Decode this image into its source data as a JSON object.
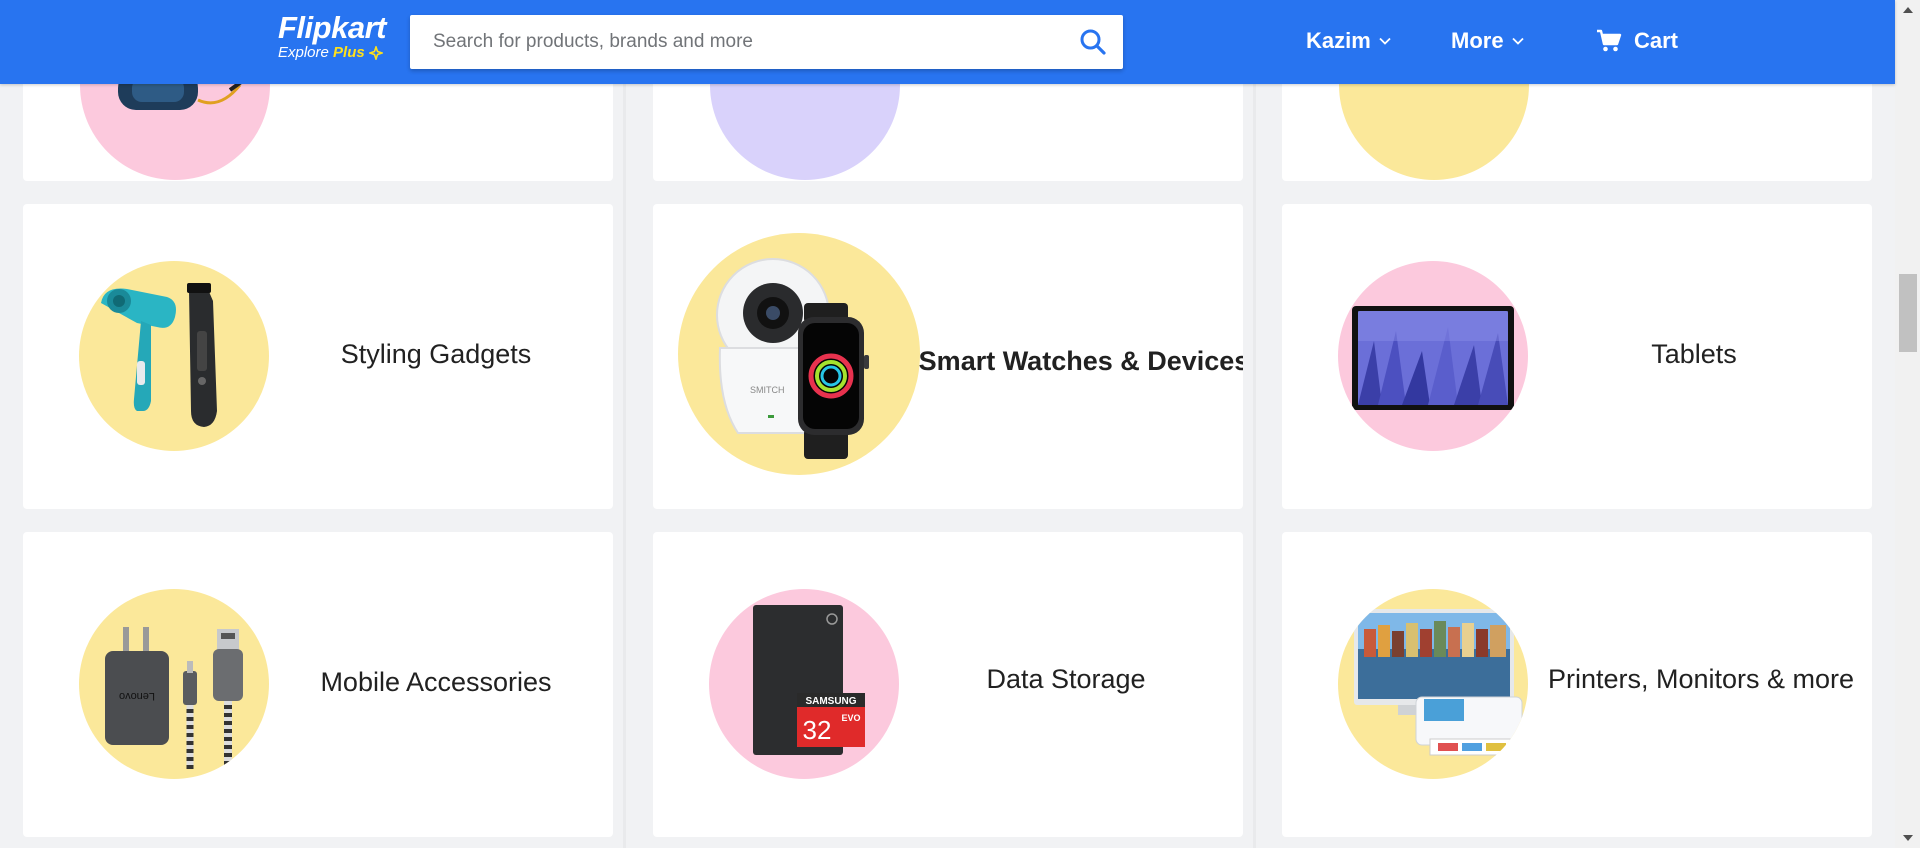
{
  "header": {
    "logo_text": "Flipkart",
    "logo_sub": "Explore",
    "logo_plus": "Plus",
    "search_placeholder": "Search for products, brands and more",
    "user_label": "Kazim",
    "more_label": "More",
    "cart_label": "Cart"
  },
  "colors": {
    "brand_blue": "#2874f0",
    "plus_yellow": "#ffe11b",
    "circle_yellow": "#fbe89a",
    "circle_pink": "#fcc9dd",
    "circle_lavender": "#d9d2fb"
  },
  "categories": [
    {
      "label": "Styling Gadgets",
      "icon": "hair-dryer-trimmer-icon",
      "bg": "yellow"
    },
    {
      "label": "Smart Watches & Devices",
      "icon": "smartwatch-camera-icon",
      "bg": "yellow"
    },
    {
      "label": "Tablets",
      "icon": "tablet-icon",
      "bg": "pink"
    },
    {
      "label": "Mobile Accessories",
      "icon": "charger-cable-icon",
      "bg": "yellow"
    },
    {
      "label": "Data Storage",
      "icon": "hard-drive-sdcard-icon",
      "bg": "pink"
    },
    {
      "label": "Printers, Monitors & more",
      "icon": "monitor-printer-icon",
      "bg": "yellow"
    }
  ],
  "partial_top_row": [
    {
      "icon": "speaker-icon",
      "bg": "pink"
    },
    {
      "icon": "unknown-product-icon",
      "bg": "lavender"
    },
    {
      "icon": "phone-icon",
      "bg": "yellow"
    }
  ],
  "sdcard": {
    "brand": "SAMSUNG",
    "capacity": "32",
    "series": "EVO"
  },
  "camera_brand": "SMITCH",
  "charger_brand": "Lenovo"
}
